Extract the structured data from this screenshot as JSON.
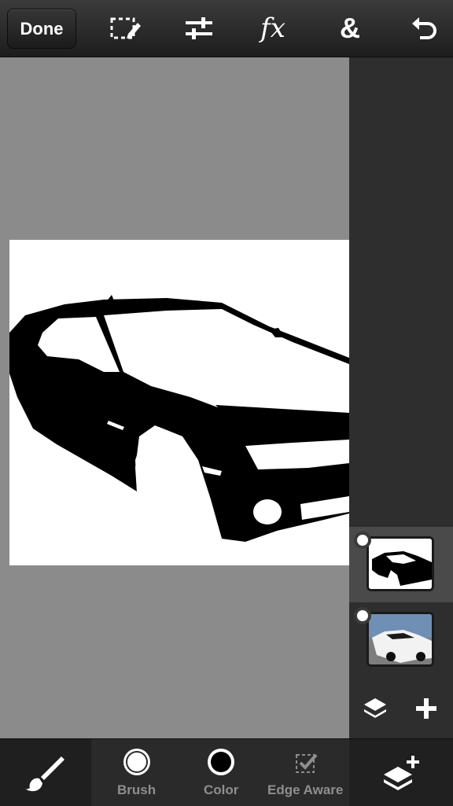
{
  "toolbar": {
    "done_label": "Done",
    "icons": [
      "selection-icon",
      "adjustments-icon",
      "fx-icon",
      "blend-icon",
      "undo-icon"
    ],
    "fx_label": "fx",
    "blend_label": "&"
  },
  "layers": {
    "items": [
      {
        "name": "silhouette-layer",
        "selected": true
      },
      {
        "name": "photo-layer",
        "selected": false
      }
    ]
  },
  "bottom_bar": {
    "brush_label": "Brush",
    "color_label": "Color",
    "edge_aware_label": "Edge Aware"
  },
  "colors": {
    "toolbar_bg": "#1d1d1d",
    "canvas_bg": "#8b8b8b",
    "panel_bg": "#2e2e2e",
    "active_layer": "#4a4a4a",
    "label_gray": "#8e8e8e"
  }
}
